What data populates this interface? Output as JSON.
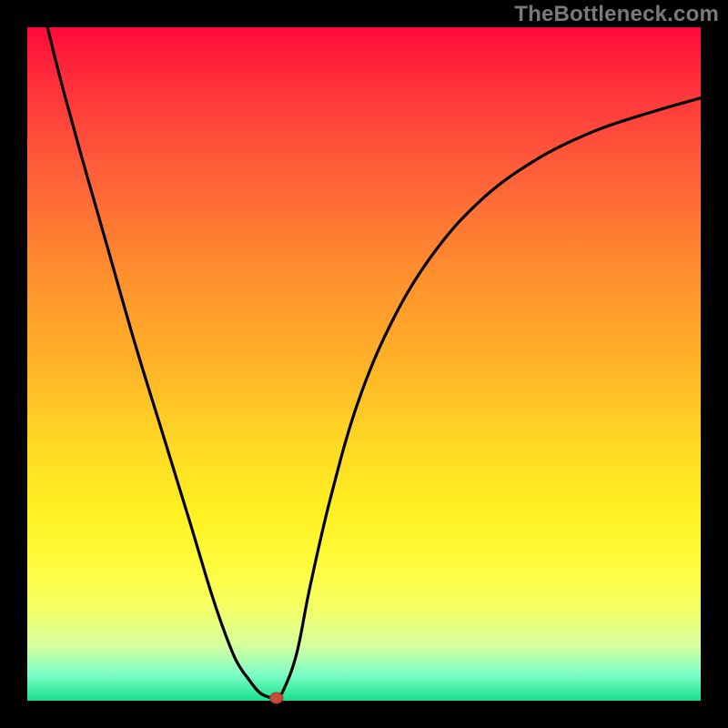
{
  "watermark": "TheBottleneck.com",
  "chart_data": {
    "type": "line",
    "title": "",
    "xlabel": "",
    "ylabel": "",
    "xlim": [
      0,
      100
    ],
    "ylim": [
      0,
      100
    ],
    "x": [
      3,
      5,
      8,
      12,
      16,
      20,
      24,
      27,
      29,
      31,
      33,
      34.5,
      36,
      37,
      38,
      40,
      42,
      45,
      49,
      54,
      60,
      67,
      75,
      84,
      93,
      100
    ],
    "values": [
      100,
      92,
      81,
      67,
      53,
      40,
      27,
      17,
      11,
      6,
      3,
      1.2,
      0.5,
      0.5,
      1.5,
      7,
      17,
      30,
      44,
      56,
      66,
      74,
      80,
      84.5,
      87.5,
      89.5
    ],
    "marker": {
      "x": 37,
      "y": 0.4
    },
    "background": "red-orange-yellow-green vertical gradient",
    "curve_color": "#000000"
  }
}
